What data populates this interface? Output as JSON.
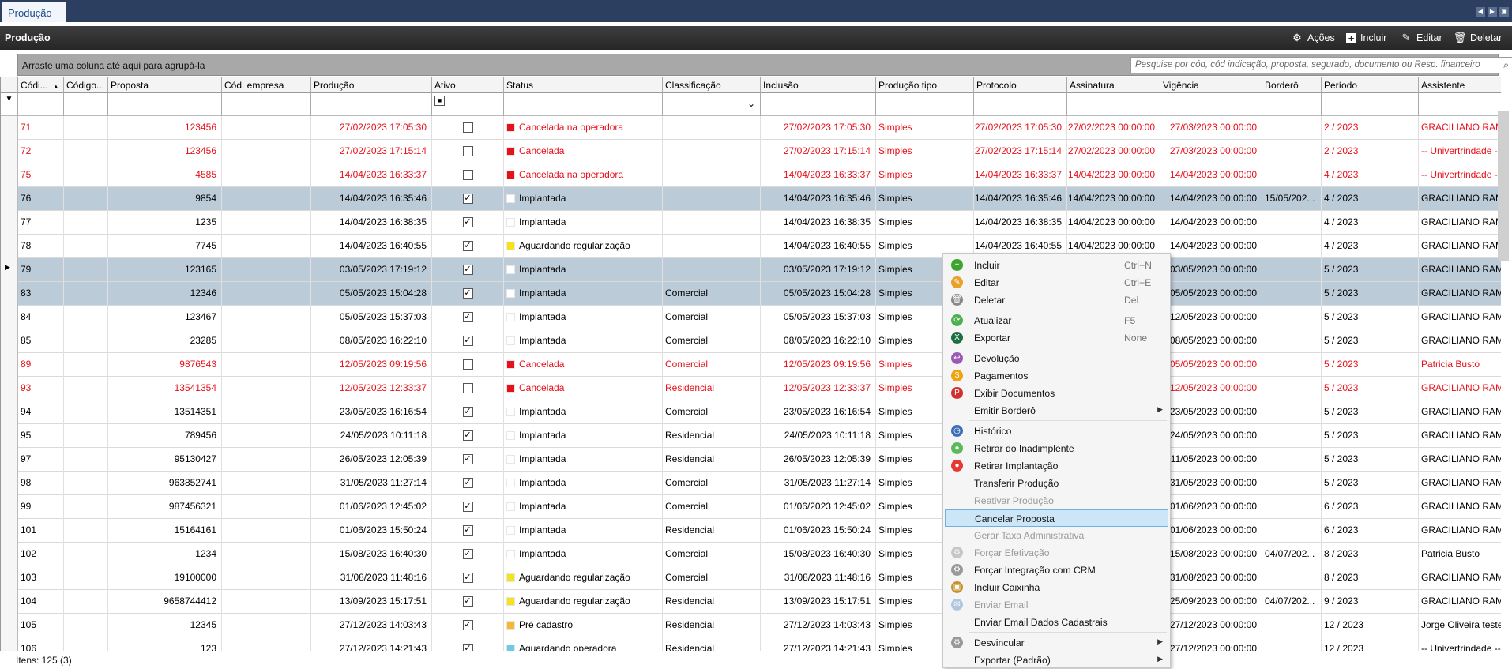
{
  "tab": {
    "label": "Produção"
  },
  "title": "Produção",
  "toolbar": {
    "acoes": "Ações",
    "incluir": "Incluir",
    "editar": "Editar",
    "deletar": "Deletar"
  },
  "grouparea": {
    "text": "Arraste uma coluna até aqui para agrupá-la"
  },
  "search": {
    "placeholder": "Pesquise por cód, cód indicação, proposta, segurado, documento ou Resp. financeiro"
  },
  "columns": [
    "Códi...",
    "Código...",
    "Proposta",
    "Cód. empresa",
    "Produção",
    "Ativo",
    "Status",
    "Classificação",
    "Inclusão",
    "Produção tipo",
    "Protocolo",
    "Assinatura",
    "Vigência",
    "Borderô",
    "Período",
    "Assistente"
  ],
  "colors": {
    "red": "#e8101a",
    "selected": "#bccbd8",
    "yellow": "#f5e11c",
    "orange": "#f7b733",
    "cyan": "#6ec9e6"
  },
  "rows": [
    {
      "cod": "71",
      "proposta": "123456",
      "producao": "27/02/2023 17:05:30",
      "ativo": false,
      "status": "Cancelada na operadora",
      "sw": "red",
      "class": "",
      "inclusao": "27/02/2023 17:05:30",
      "tipo": "Simples",
      "protocolo": "27/02/2023 17:05:30",
      "assinatura": "27/02/2023 00:00:00",
      "vigencia": "27/03/2023 00:00:00",
      "bordero": "",
      "periodo": "2 / 2023",
      "assistente": "GRACILIANO RAMOS",
      "red": true
    },
    {
      "cod": "72",
      "proposta": "123456",
      "producao": "27/02/2023 17:15:14",
      "ativo": false,
      "status": "Cancelada",
      "sw": "red",
      "class": "",
      "inclusao": "27/02/2023 17:15:14",
      "tipo": "Simples",
      "protocolo": "27/02/2023 17:15:14",
      "assinatura": "27/02/2023 00:00:00",
      "vigencia": "27/03/2023 00:00:00",
      "bordero": "",
      "periodo": "2 / 2023",
      "assistente": "-- Univertrindade --",
      "red": true
    },
    {
      "cod": "75",
      "proposta": "4585",
      "producao": "14/04/2023 16:33:37",
      "ativo": false,
      "status": "Cancelada na operadora",
      "sw": "red",
      "class": "",
      "inclusao": "14/04/2023 16:33:37",
      "tipo": "Simples",
      "protocolo": "14/04/2023 16:33:37",
      "assinatura": "14/04/2023 00:00:00",
      "vigencia": "14/04/2023 00:00:00",
      "bordero": "",
      "periodo": "4 / 2023",
      "assistente": "-- Univertrindade --",
      "red": true
    },
    {
      "cod": "76",
      "proposta": "9854",
      "producao": "14/04/2023 16:35:46",
      "ativo": true,
      "status": "Implantada",
      "sw": "white",
      "class": "",
      "inclusao": "14/04/2023 16:35:46",
      "tipo": "Simples",
      "protocolo": "14/04/2023 16:35:46",
      "assinatura": "14/04/2023 00:00:00",
      "vigencia": "14/04/2023 00:00:00",
      "bordero": "15/05/202...",
      "periodo": "4 / 2023",
      "assistente": "GRACILIANO RAMOS",
      "sel": true
    },
    {
      "cod": "77",
      "proposta": "1235",
      "producao": "14/04/2023 16:38:35",
      "ativo": true,
      "status": "Implantada",
      "sw": "white",
      "class": "",
      "inclusao": "14/04/2023 16:38:35",
      "tipo": "Simples",
      "protocolo": "14/04/2023 16:38:35",
      "assinatura": "14/04/2023 00:00:00",
      "vigencia": "14/04/2023 00:00:00",
      "bordero": "",
      "periodo": "4 / 2023",
      "assistente": "GRACILIANO RAMOS"
    },
    {
      "cod": "78",
      "proposta": "7745",
      "producao": "14/04/2023 16:40:55",
      "ativo": true,
      "status": "Aguardando regularização",
      "sw": "yellow",
      "class": "",
      "inclusao": "14/04/2023 16:40:55",
      "tipo": "Simples",
      "protocolo": "14/04/2023 16:40:55",
      "assinatura": "14/04/2023 00:00:00",
      "vigencia": "14/04/2023 00:00:00",
      "bordero": "",
      "periodo": "4 / 2023",
      "assistente": "GRACILIANO RAMOS"
    },
    {
      "cod": "79",
      "proposta": "123165",
      "producao": "03/05/2023 17:19:12",
      "ativo": true,
      "status": "Implantada",
      "sw": "white",
      "class": "",
      "inclusao": "03/05/2023 17:19:12",
      "tipo": "Simples",
      "protocolo": "",
      "assinatura": "",
      "vigencia": "03/05/2023 00:00:00",
      "bordero": "",
      "periodo": "5 / 2023",
      "assistente": "GRACILIANO RAMOS",
      "sel": true,
      "cur": true
    },
    {
      "cod": "83",
      "proposta": "12346",
      "producao": "05/05/2023 15:04:28",
      "ativo": true,
      "status": "Implantada",
      "sw": "white",
      "class": "Comercial",
      "inclusao": "05/05/2023 15:04:28",
      "tipo": "Simples",
      "protocolo": "",
      "assinatura": "",
      "vigencia": "05/05/2023 00:00:00",
      "bordero": "",
      "periodo": "5 / 2023",
      "assistente": "GRACILIANO RAMOS",
      "sel": true
    },
    {
      "cod": "84",
      "proposta": "123467",
      "producao": "05/05/2023 15:37:03",
      "ativo": true,
      "status": "Implantada",
      "sw": "white",
      "class": "Comercial",
      "inclusao": "05/05/2023 15:37:03",
      "tipo": "Simples",
      "protocolo": "",
      "assinatura": "",
      "vigencia": "12/05/2023 00:00:00",
      "bordero": "",
      "periodo": "5 / 2023",
      "assistente": "GRACILIANO RAMOS"
    },
    {
      "cod": "85",
      "proposta": "23285",
      "producao": "08/05/2023 16:22:10",
      "ativo": true,
      "status": "Implantada",
      "sw": "white",
      "class": "Comercial",
      "inclusao": "08/05/2023 16:22:10",
      "tipo": "Simples",
      "protocolo": "",
      "assinatura": "",
      "vigencia": "08/05/2023 00:00:00",
      "bordero": "",
      "periodo": "5 / 2023",
      "assistente": "GRACILIANO RAMOS"
    },
    {
      "cod": "89",
      "proposta": "9876543",
      "producao": "12/05/2023 09:19:56",
      "ativo": false,
      "status": "Cancelada",
      "sw": "red",
      "class": "Comercial",
      "inclusao": "12/05/2023 09:19:56",
      "tipo": "Simples",
      "protocolo": "",
      "assinatura": "",
      "vigencia": "05/05/2023 00:00:00",
      "bordero": "",
      "periodo": "5 / 2023",
      "assistente": "Patricia Busto",
      "red": true
    },
    {
      "cod": "93",
      "proposta": "13541354",
      "producao": "12/05/2023 12:33:37",
      "ativo": false,
      "status": "Cancelada",
      "sw": "red",
      "class": "Residencial",
      "inclusao": "12/05/2023 12:33:37",
      "tipo": "Simples",
      "protocolo": "",
      "assinatura": "",
      "vigencia": "12/05/2023 00:00:00",
      "bordero": "",
      "periodo": "5 / 2023",
      "assistente": "GRACILIANO RAMOS",
      "red": true
    },
    {
      "cod": "94",
      "proposta": "13514351",
      "producao": "23/05/2023 16:16:54",
      "ativo": true,
      "status": "Implantada",
      "sw": "white",
      "class": "Comercial",
      "inclusao": "23/05/2023 16:16:54",
      "tipo": "Simples",
      "protocolo": "",
      "assinatura": "",
      "vigencia": "23/05/2023 00:00:00",
      "bordero": "",
      "periodo": "5 / 2023",
      "assistente": "GRACILIANO RAMOS"
    },
    {
      "cod": "95",
      "proposta": "789456",
      "producao": "24/05/2023 10:11:18",
      "ativo": true,
      "status": "Implantada",
      "sw": "white",
      "class": "Residencial",
      "inclusao": "24/05/2023 10:11:18",
      "tipo": "Simples",
      "protocolo": "",
      "assinatura": "",
      "vigencia": "24/05/2023 00:00:00",
      "bordero": "",
      "periodo": "5 / 2023",
      "assistente": "GRACILIANO RAMOS"
    },
    {
      "cod": "97",
      "proposta": "95130427",
      "producao": "26/05/2023 12:05:39",
      "ativo": true,
      "status": "Implantada",
      "sw": "white",
      "class": "Residencial",
      "inclusao": "26/05/2023 12:05:39",
      "tipo": "Simples",
      "protocolo": "",
      "assinatura": "",
      "vigencia": "11/05/2023 00:00:00",
      "bordero": "",
      "periodo": "5 / 2023",
      "assistente": "GRACILIANO RAMOS"
    },
    {
      "cod": "98",
      "proposta": "963852741",
      "producao": "31/05/2023 11:27:14",
      "ativo": true,
      "status": "Implantada",
      "sw": "white",
      "class": "Comercial",
      "inclusao": "31/05/2023 11:27:14",
      "tipo": "Simples",
      "protocolo": "",
      "assinatura": "",
      "vigencia": "31/05/2023 00:00:00",
      "bordero": "",
      "periodo": "5 / 2023",
      "assistente": "GRACILIANO RAMOS"
    },
    {
      "cod": "99",
      "proposta": "987456321",
      "producao": "01/06/2023 12:45:02",
      "ativo": true,
      "status": "Implantada",
      "sw": "white",
      "class": "Comercial",
      "inclusao": "01/06/2023 12:45:02",
      "tipo": "Simples",
      "protocolo": "",
      "assinatura": "",
      "vigencia": "01/06/2023 00:00:00",
      "bordero": "",
      "periodo": "6 / 2023",
      "assistente": "GRACILIANO RAMOS"
    },
    {
      "cod": "101",
      "proposta": "15164161",
      "producao": "01/06/2023 15:50:24",
      "ativo": true,
      "status": "Implantada",
      "sw": "white",
      "class": "Residencial",
      "inclusao": "01/06/2023 15:50:24",
      "tipo": "Simples",
      "protocolo": "",
      "assinatura": "",
      "vigencia": "01/06/2023 00:00:00",
      "bordero": "",
      "periodo": "6 / 2023",
      "assistente": "GRACILIANO RAMOS"
    },
    {
      "cod": "102",
      "proposta": "1234",
      "producao": "15/08/2023 16:40:30",
      "ativo": true,
      "status": "Implantada",
      "sw": "white",
      "class": "Comercial",
      "inclusao": "15/08/2023 16:40:30",
      "tipo": "Simples",
      "protocolo": "",
      "assinatura": "",
      "vigencia": "15/08/2023 00:00:00",
      "bordero": "04/07/202...",
      "periodo": "8 / 2023",
      "assistente": "Patricia Busto"
    },
    {
      "cod": "103",
      "proposta": "19100000",
      "producao": "31/08/2023 11:48:16",
      "ativo": true,
      "status": "Aguardando regularização",
      "sw": "yellow",
      "class": "Comercial",
      "inclusao": "31/08/2023 11:48:16",
      "tipo": "Simples",
      "protocolo": "",
      "assinatura": "",
      "vigencia": "31/08/2023 00:00:00",
      "bordero": "",
      "periodo": "8 / 2023",
      "assistente": "GRACILIANO RAMOS"
    },
    {
      "cod": "104",
      "proposta": "9658744412",
      "producao": "13/09/2023 15:17:51",
      "ativo": true,
      "status": "Aguardando regularização",
      "sw": "yellow",
      "class": "Residencial",
      "inclusao": "13/09/2023 15:17:51",
      "tipo": "Simples",
      "protocolo": "",
      "assinatura": "",
      "vigencia": "25/09/2023 00:00:00",
      "bordero": "04/07/202...",
      "periodo": "9 / 2023",
      "assistente": "GRACILIANO RAMOS"
    },
    {
      "cod": "105",
      "proposta": "12345",
      "producao": "27/12/2023 14:03:43",
      "ativo": true,
      "status": "Pré cadastro",
      "sw": "orange",
      "class": "Residencial",
      "inclusao": "27/12/2023 14:03:43",
      "tipo": "Simples",
      "protocolo": "",
      "assinatura": "",
      "vigencia": "27/12/2023 00:00:00",
      "bordero": "",
      "periodo": "12 / 2023",
      "assistente": "Jorge Oliveira teste"
    },
    {
      "cod": "106",
      "proposta": "123",
      "producao": "27/12/2023 14:21:43",
      "ativo": true,
      "status": "Aguardando operadora",
      "sw": "cyan",
      "class": "Residencial",
      "inclusao": "27/12/2023 14:21:43",
      "tipo": "Simples",
      "protocolo": "",
      "assinatura": "",
      "vigencia": "27/12/2023 00:00:00",
      "bordero": "",
      "periodo": "12 / 2023",
      "assistente": "-- Univertrindade --"
    }
  ],
  "footer": {
    "items": "Itens: 125 (3)"
  },
  "context_menu": [
    {
      "label": "Incluir",
      "shortcut": "Ctrl+N",
      "icon": "add-icon",
      "sep_after": false
    },
    {
      "label": "Editar",
      "shortcut": "Ctrl+E",
      "icon": "edit-icon"
    },
    {
      "label": "Deletar",
      "shortcut": "Del",
      "icon": "trash-icon",
      "sep_after": true
    },
    {
      "label": "Atualizar",
      "shortcut": "F5",
      "icon": "refresh-icon"
    },
    {
      "label": "Exportar",
      "shortcut": "None",
      "icon": "excel-icon",
      "sep_after": true
    },
    {
      "label": "Devolução",
      "shortcut": "",
      "icon": "return-icon"
    },
    {
      "label": "Pagamentos",
      "shortcut": "",
      "icon": "payments-icon"
    },
    {
      "label": "Exibir Documentos",
      "shortcut": "",
      "icon": "pdf-icon"
    },
    {
      "label": "Emitir Borderô",
      "shortcut": "",
      "icon": "",
      "submenu": true,
      "sep_after": true
    },
    {
      "label": "Histórico",
      "shortcut": "",
      "icon": "history-icon"
    },
    {
      "label": "Retirar do Inadimplente",
      "shortcut": "",
      "icon": "green-dot-icon"
    },
    {
      "label": "Retirar Implantação",
      "shortcut": "",
      "icon": "red-dot-icon"
    },
    {
      "label": "Transferir Produção",
      "shortcut": "",
      "icon": ""
    },
    {
      "label": "Reativar Produção",
      "shortcut": "",
      "icon": "",
      "disabled": true
    },
    {
      "label": "Cancelar Proposta",
      "shortcut": "",
      "icon": "",
      "highlighted": true
    },
    {
      "label": "Gerar Taxa Administrativa",
      "shortcut": "",
      "icon": "",
      "disabled": true
    },
    {
      "label": "Forçar Efetivação",
      "shortcut": "",
      "icon": "gear-icon",
      "disabled": true
    },
    {
      "label": "Forçar Integração com CRM",
      "shortcut": "",
      "icon": "gear-icon"
    },
    {
      "label": "Incluir Caixinha",
      "shortcut": "",
      "icon": "box-icon"
    },
    {
      "label": "Enviar Email",
      "shortcut": "",
      "icon": "email-icon",
      "disabled": true
    },
    {
      "label": "Enviar Email Dados Cadastrais",
      "shortcut": "",
      "icon": "",
      "sep_after": true
    },
    {
      "label": "Desvincular",
      "shortcut": "",
      "icon": "gear-icon",
      "submenu": true
    },
    {
      "label": "Exportar (Padrão)",
      "shortcut": "",
      "icon": "",
      "submenu": true
    }
  ]
}
